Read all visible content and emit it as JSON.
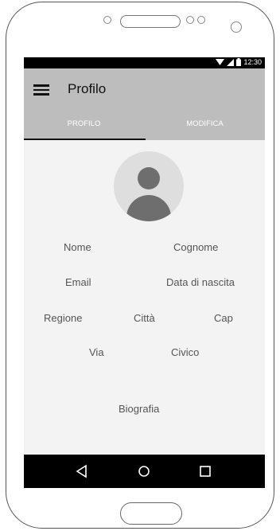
{
  "status_bar": {
    "time": "12:30"
  },
  "app_bar": {
    "title": "Profilo"
  },
  "tabs": [
    {
      "label": "PROFILO",
      "active": true
    },
    {
      "label": "MODIFICA",
      "active": false
    }
  ],
  "profile_fields": {
    "nome": "Nome",
    "cognome": "Cognome",
    "email": "Email",
    "data_nascita": "Data di nascita",
    "regione": "Regione",
    "citta": "Città",
    "cap": "Cap",
    "via": "Via",
    "civico": "Civico",
    "biografia": "Biografia"
  },
  "icons": {
    "menu": "menu-icon",
    "avatar": "person-icon",
    "nav_back": "back-triangle-icon",
    "nav_home": "home-circle-icon",
    "nav_recents": "recents-square-icon",
    "wifi": "wifi-icon",
    "signal": "signal-icon",
    "battery": "battery-icon"
  },
  "colors": {
    "app_bar": "#bdbdbd",
    "background": "#f3f3f3",
    "tab_indicator": "#111111",
    "nav_bar": "#000000"
  }
}
